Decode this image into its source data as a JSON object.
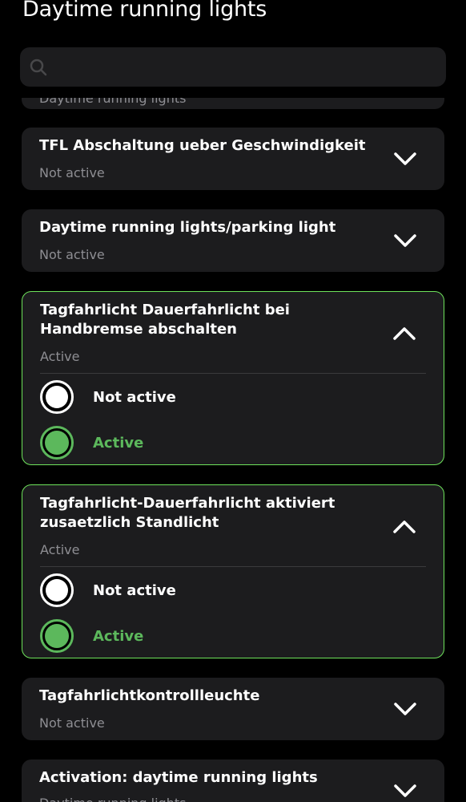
{
  "header": {
    "title": "Daytime running lights"
  },
  "search": {
    "placeholder": ""
  },
  "peek": {
    "text": "Daytime running lights"
  },
  "cards": [
    {
      "title": "TFL Abschaltung ueber Geschwindigkeit",
      "status": "Not active",
      "expanded": false
    },
    {
      "title": "Daytime running lights/parking light",
      "status": "Not active",
      "expanded": false
    },
    {
      "title": "Tagfahrlicht Dauerfahrlicht bei Handbremse abschalten",
      "status": "Active",
      "expanded": true,
      "options": [
        {
          "label": "Not active",
          "selected": false
        },
        {
          "label": "Active",
          "selected": true
        }
      ]
    },
    {
      "title": "Tagfahrlicht-Dauerfahrlicht aktiviert zusaetzlich Standlicht",
      "status": "Active",
      "expanded": true,
      "options": [
        {
          "label": "Not active",
          "selected": false
        },
        {
          "label": "Active",
          "selected": true
        }
      ]
    },
    {
      "title": "Tagfahrlichtkontrollleuchte",
      "status": "Not active",
      "expanded": false
    },
    {
      "title": "Activation: daytime running lights",
      "status": "Daytime running lights",
      "expanded": false
    }
  ],
  "colors": {
    "accent": "#5cb85c",
    "active_border": "#6ee35b",
    "card_bg": "#1c1c1e",
    "muted_text": "#8e8e93"
  },
  "icons": {
    "search": "search-icon",
    "collapsed": "chevron-down-icon",
    "expanded": "chevron-up-icon"
  }
}
